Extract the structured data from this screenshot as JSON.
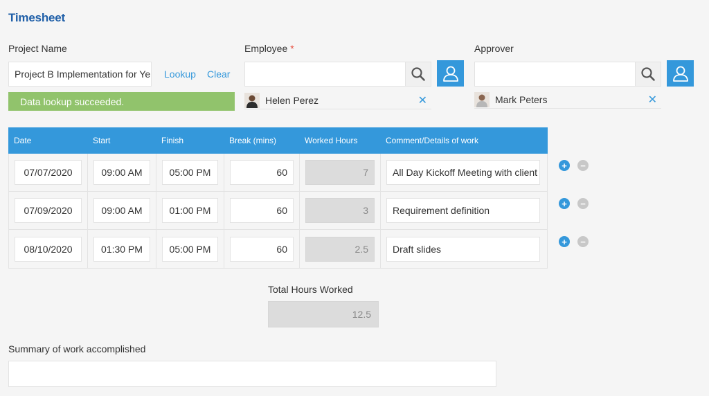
{
  "page": {
    "title": "Timesheet"
  },
  "project": {
    "label": "Project Name",
    "value": "Project B Implementation for Yello",
    "lookup_label": "Lookup",
    "clear_label": "Clear",
    "success_message": "Data lookup succeeded."
  },
  "employee": {
    "label": "Employee",
    "required_mark": "*",
    "value": "",
    "selected_user": "Helen Perez",
    "remove_glyph": "✕"
  },
  "approver": {
    "label": "Approver",
    "value": "",
    "selected_user": "Mark Peters",
    "remove_glyph": "✕"
  },
  "table": {
    "headers": [
      "Date",
      "Start",
      "Finish",
      "Break (mins)",
      "Worked Hours",
      "Comment/Details of work"
    ],
    "rows": [
      {
        "date": "07/07/2020",
        "start": "09:00 AM",
        "finish": "05:00 PM",
        "break": "60",
        "worked": "7",
        "comment": "All Day Kickoff Meeting with client"
      },
      {
        "date": "07/09/2020",
        "start": "09:00 AM",
        "finish": "01:00 PM",
        "break": "60",
        "worked": "3",
        "comment": "Requirement definition"
      },
      {
        "date": "08/10/2020",
        "start": "01:30 PM",
        "finish": "05:00 PM",
        "break": "60",
        "worked": "2.5",
        "comment": "Draft slides"
      }
    ],
    "add_glyph": "+",
    "remove_glyph": "−"
  },
  "total": {
    "label": "Total Hours Worked",
    "value": "12.5"
  },
  "summary": {
    "label": "Summary of work accomplished",
    "value": ""
  },
  "colors": {
    "accent": "#3498db",
    "title": "#1f5fa8",
    "success": "#91c36c",
    "required": "#e74c3c"
  },
  "icons": [
    "search-icon",
    "user-icon",
    "close-icon",
    "plus-icon",
    "minus-icon"
  ]
}
